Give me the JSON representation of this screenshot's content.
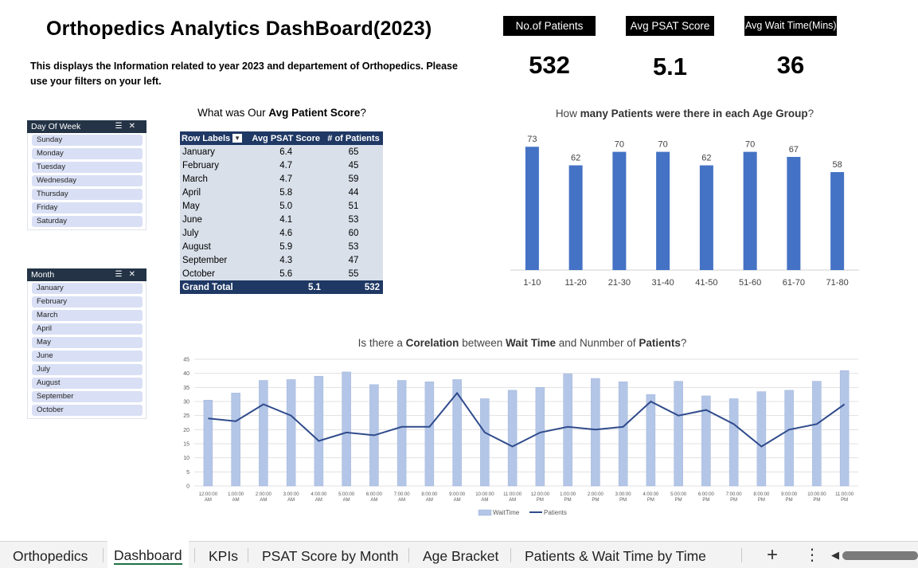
{
  "dashboard": {
    "title": "Orthopedics Analytics DashBoard(2023)",
    "subtitle": "This displays the Information related to year 2023 and departement of Orthopedics. Please use your filters on your left."
  },
  "kpis": [
    {
      "label": "No.of Patients",
      "value": "532"
    },
    {
      "label": "Avg PSAT Score",
      "value": "5.1"
    },
    {
      "label": "Avg Wait Time(Mins)",
      "value": "36"
    }
  ],
  "slicers": {
    "day_of_week": {
      "header": "Day Of Week",
      "items": [
        "Sunday",
        "Monday",
        "Tuesday",
        "Wednesday",
        "Thursday",
        "Friday",
        "Saturday"
      ]
    },
    "month": {
      "header": "Month",
      "items": [
        "January",
        "February",
        "March",
        "April",
        "May",
        "June",
        "July",
        "August",
        "September",
        "October"
      ]
    }
  },
  "pivot": {
    "title_pre": "What was Our ",
    "title_bold": "Avg Patient Score",
    "title_post": "?",
    "headers": [
      "Row Labels",
      "Avg PSAT Score",
      "# of Patients"
    ],
    "rows": [
      [
        "January",
        "6.4",
        "65"
      ],
      [
        "February",
        "4.7",
        "45"
      ],
      [
        "March",
        "4.7",
        "59"
      ],
      [
        "April",
        "5.8",
        "44"
      ],
      [
        "May",
        "5.0",
        "51"
      ],
      [
        "June",
        "4.1",
        "53"
      ],
      [
        "July",
        "4.6",
        "60"
      ],
      [
        "August",
        "5.9",
        "53"
      ],
      [
        "September",
        "4.3",
        "47"
      ],
      [
        "October",
        "5.6",
        "55"
      ]
    ],
    "total": [
      "Grand Total",
      "5.1",
      "532"
    ]
  },
  "age_chart": {
    "title_pre": "How ",
    "title_bold": "many Patients were there in each Age Group",
    "title_post": "?"
  },
  "corr_chart": {
    "title_1": "Is there a ",
    "title_b1": "Corelation",
    "title_2": " between ",
    "title_b2": "Wait Time",
    "title_3": " and Nunmber of ",
    "title_b3": "Patients",
    "title_4": "?"
  },
  "chart_data": [
    {
      "type": "bar",
      "categories": [
        "1-10",
        "11-20",
        "21-30",
        "31-40",
        "41-50",
        "51-60",
        "61-70",
        "71-80"
      ],
      "values": [
        73,
        62,
        70,
        70,
        62,
        70,
        67,
        58
      ],
      "title": "How many Patients were there in each Age Group?",
      "ylim": [
        0,
        75
      ],
      "grid": false,
      "data_labels": true,
      "colors": {
        "bar": "#4472c4"
      }
    },
    {
      "type": "bar",
      "categories": [
        "12:00:00 AM",
        "1:00:00 AM",
        "2:00:00 AM",
        "3:00:00 AM",
        "4:00:00 AM",
        "5:00:00 AM",
        "6:00:00 AM",
        "7:00:00 AM",
        "8:00:00 AM",
        "9:00:00 AM",
        "10:00:00 AM",
        "11:00:00 AM",
        "12:00:00 PM",
        "1:00:00 PM",
        "2:00:00 PM",
        "3:00:00 PM",
        "4:00:00 PM",
        "5:00:00 PM",
        "6:00:00 PM",
        "7:00:00 PM",
        "8:00:00 PM",
        "9:00:00 PM",
        "10:00:00 PM",
        "11:00:00 PM"
      ],
      "series": [
        {
          "name": "WaitTime",
          "type": "bar",
          "values": [
            30.5,
            33,
            37.5,
            37.8,
            39,
            40.5,
            36,
            37.5,
            37,
            37.8,
            31,
            34,
            35,
            39.8,
            38.2,
            37,
            32.5,
            37.2,
            32,
            31,
            33.5,
            34,
            37.2,
            41
          ]
        },
        {
          "name": "Patients",
          "type": "line",
          "values": [
            24,
            23,
            29,
            25,
            16,
            19,
            18,
            21,
            21,
            33,
            19,
            14,
            19,
            21,
            20,
            21,
            30,
            25,
            27,
            22,
            14,
            20,
            22,
            29
          ]
        }
      ],
      "title": "Is there a Corelation between Wait Time and Nunmber of Patients?",
      "yticks": [
        "0",
        "5",
        "10",
        "15",
        "20",
        "25",
        "30",
        "35",
        "40",
        "45"
      ],
      "ylim": [
        0,
        45
      ],
      "grid": true,
      "legend": "bottom",
      "colors": {
        "bar": "#b4c6e7",
        "line": "#2f4b8c"
      }
    }
  ],
  "tabs": [
    {
      "label": "Orthopedics",
      "active": false
    },
    {
      "label": "Dashboard",
      "active": true
    },
    {
      "label": "KPIs",
      "active": false
    },
    {
      "label": "PSAT Score by Month",
      "active": false
    },
    {
      "label": "Age Bracket",
      "active": false
    },
    {
      "label": "Patients & Wait Time by Time",
      "active": false
    }
  ],
  "tabbar": {
    "add_label": "+",
    "more_label": "⋮",
    "scroll_left_label": "◀"
  }
}
